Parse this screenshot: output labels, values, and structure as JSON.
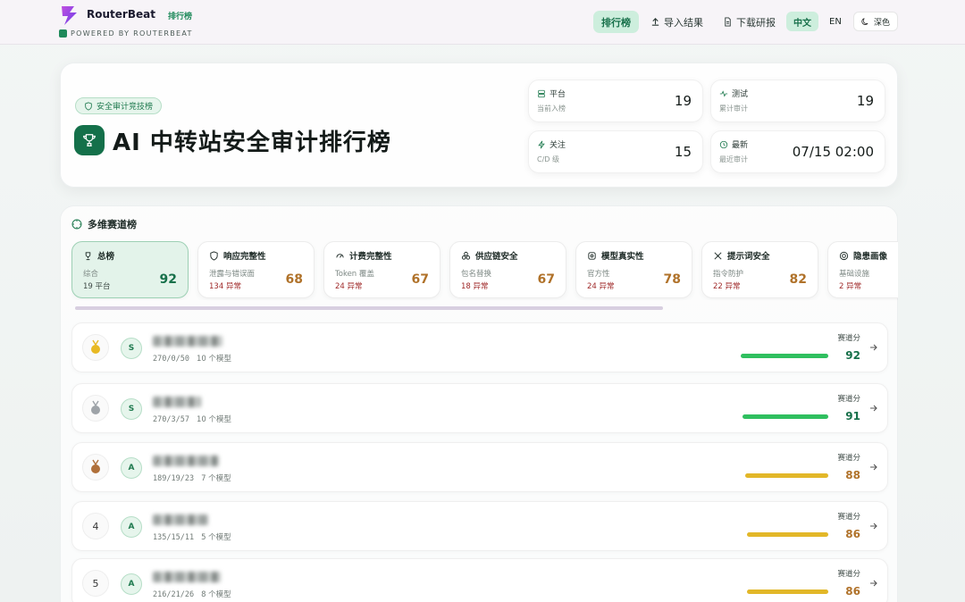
{
  "header": {
    "brand": "RouterBeat",
    "brand_tag": "排行榜",
    "powered": "POWERED BY ROUTERBEAT",
    "nav": [
      {
        "label": "排行榜",
        "icon": "none",
        "active": true
      },
      {
        "label": "导入结果",
        "icon": "upload-icon",
        "active": false
      },
      {
        "label": "下载研报",
        "icon": "document-icon",
        "active": false
      }
    ],
    "lang": {
      "zh": "中文",
      "en": "EN"
    },
    "theme_label": "深色"
  },
  "hero": {
    "badge": "安全审计竞技榜",
    "title": "AI 中转站安全审计排行榜",
    "stats": [
      {
        "label": "平台",
        "sub": "当前入榜",
        "value": "19",
        "icon": "server-icon"
      },
      {
        "label": "测试",
        "sub": "累计审计",
        "value": "19",
        "icon": "pulse-icon"
      },
      {
        "label": "关注",
        "sub": "C/D 级",
        "value": "15",
        "icon": "bolt-icon"
      },
      {
        "label": "最新",
        "sub": "最近审计",
        "value": "07/15 02:00",
        "icon": "clock-icon"
      }
    ]
  },
  "section": {
    "title": "多维赛道榜",
    "tracks": [
      {
        "name": "总榜",
        "desc": "综合",
        "count": "19",
        "count_label": "平台",
        "score": "92",
        "active": true,
        "icon": "trophy-icon"
      },
      {
        "name": "响应完整性",
        "desc": "泄露与错误面",
        "count": "134",
        "count_label": "异常",
        "score": "68",
        "active": false,
        "icon": "shield-icon"
      },
      {
        "name": "计费完整性",
        "desc": "Token 覆盖",
        "count": "24",
        "count_label": "异常",
        "score": "67",
        "active": false,
        "icon": "gauge-icon"
      },
      {
        "name": "供应链安全",
        "desc": "包名替换",
        "count": "18",
        "count_label": "异常",
        "score": "67",
        "active": false,
        "icon": "boxes-icon"
      },
      {
        "name": "模型真实性",
        "desc": "官方性",
        "count": "24",
        "count_label": "异常",
        "score": "78",
        "active": false,
        "icon": "chip-icon"
      },
      {
        "name": "提示词安全",
        "desc": "指令防护",
        "count": "22",
        "count_label": "异常",
        "score": "82",
        "active": false,
        "icon": "tools-icon"
      },
      {
        "name": "隐患画像",
        "desc": "基础设施",
        "count": "2",
        "count_label": "异常",
        "score": "",
        "active": false,
        "icon": "radar-icon"
      }
    ],
    "score_label": "赛道分",
    "rows": [
      {
        "rank": "1",
        "medal": "gold",
        "grade": "S",
        "meta": "270/0/50",
        "models": "10 个模型",
        "score": 92,
        "score_text": "92",
        "color": "#2fbf5f",
        "score_color": "#17704a"
      },
      {
        "rank": "2",
        "medal": "silver",
        "grade": "S",
        "meta": "270/3/57",
        "models": "10 个模型",
        "score": 91,
        "score_text": "91",
        "color": "#2fbf5f",
        "score_color": "#17704a"
      },
      {
        "rank": "3",
        "medal": "bronze",
        "grade": "A",
        "meta": "189/19/23",
        "models": "7 个模型",
        "score": 88,
        "score_text": "88",
        "color": "#e2b728",
        "score_color": "#b0722a"
      },
      {
        "rank": "4",
        "medal": "none",
        "grade": "A",
        "meta": "135/15/11",
        "models": "5 个模型",
        "score": 86,
        "score_text": "86",
        "color": "#e2b728",
        "score_color": "#b0722a"
      },
      {
        "rank": "5",
        "medal": "none",
        "grade": "A",
        "meta": "216/21/26",
        "models": "8 个模型",
        "score": 86,
        "score_text": "86",
        "color": "#e2b728",
        "score_color": "#b0722a"
      }
    ]
  }
}
